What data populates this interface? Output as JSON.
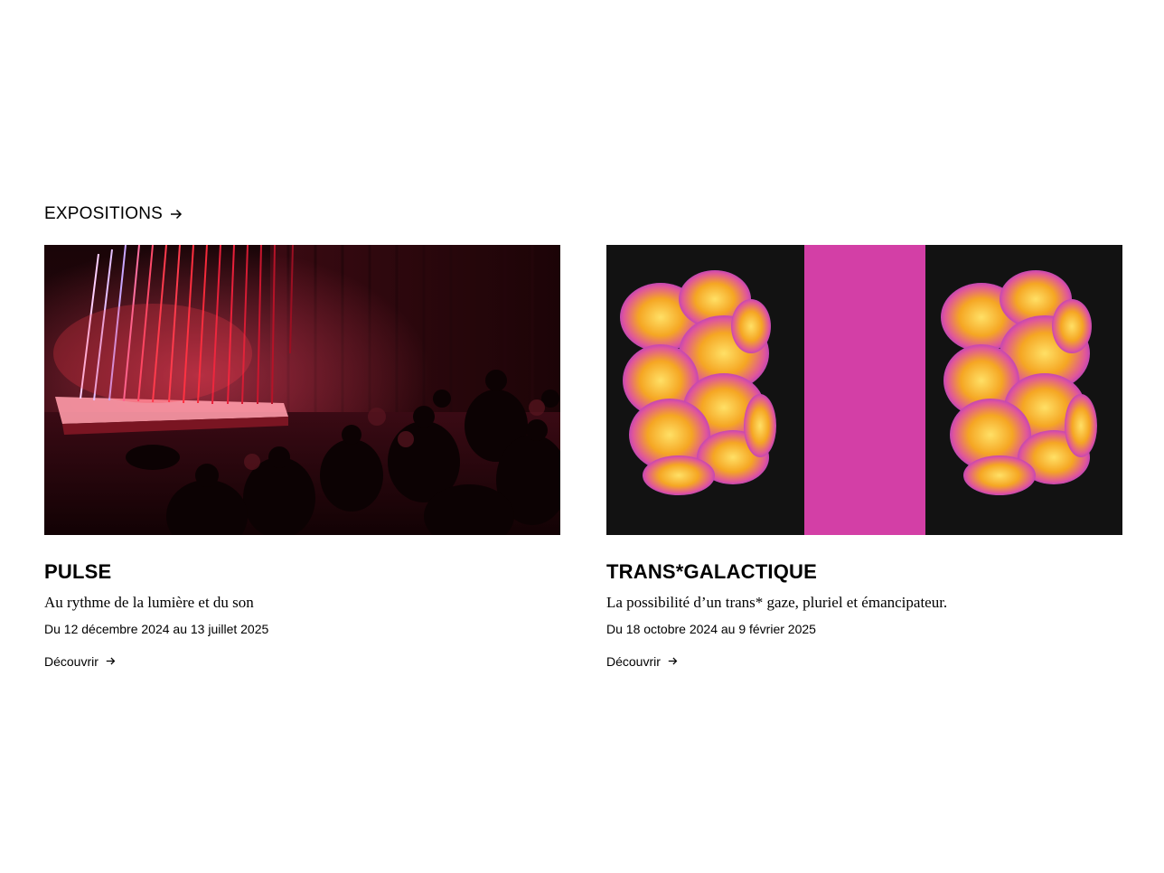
{
  "section": {
    "title": "EXPOSITIONS",
    "arrow_icon": "arrow-right-icon"
  },
  "exhibitions": [
    {
      "title": "PULSE",
      "subtitle": "Au rythme de la lumière et du son",
      "dates": "Du 12 décembre 2024 au 13 juillet 2025",
      "link_label": "Découvrir",
      "image": "light-installation-photo"
    },
    {
      "title": "TRANS*GALACTIQUE",
      "subtitle": "La possibilité d’un trans* gaze, pluriel et émancipateur.",
      "dates": "Du 18 octobre 2024 au 9 février 2025",
      "link_label": "Découvrir",
      "image": "thermal-bodies-artwork"
    }
  ],
  "colors": {
    "magenta": "#d33fa6",
    "thermal_orange": "#f5a623",
    "thermal_purple": "#8a2be2",
    "stage_red": "#e8203a"
  }
}
